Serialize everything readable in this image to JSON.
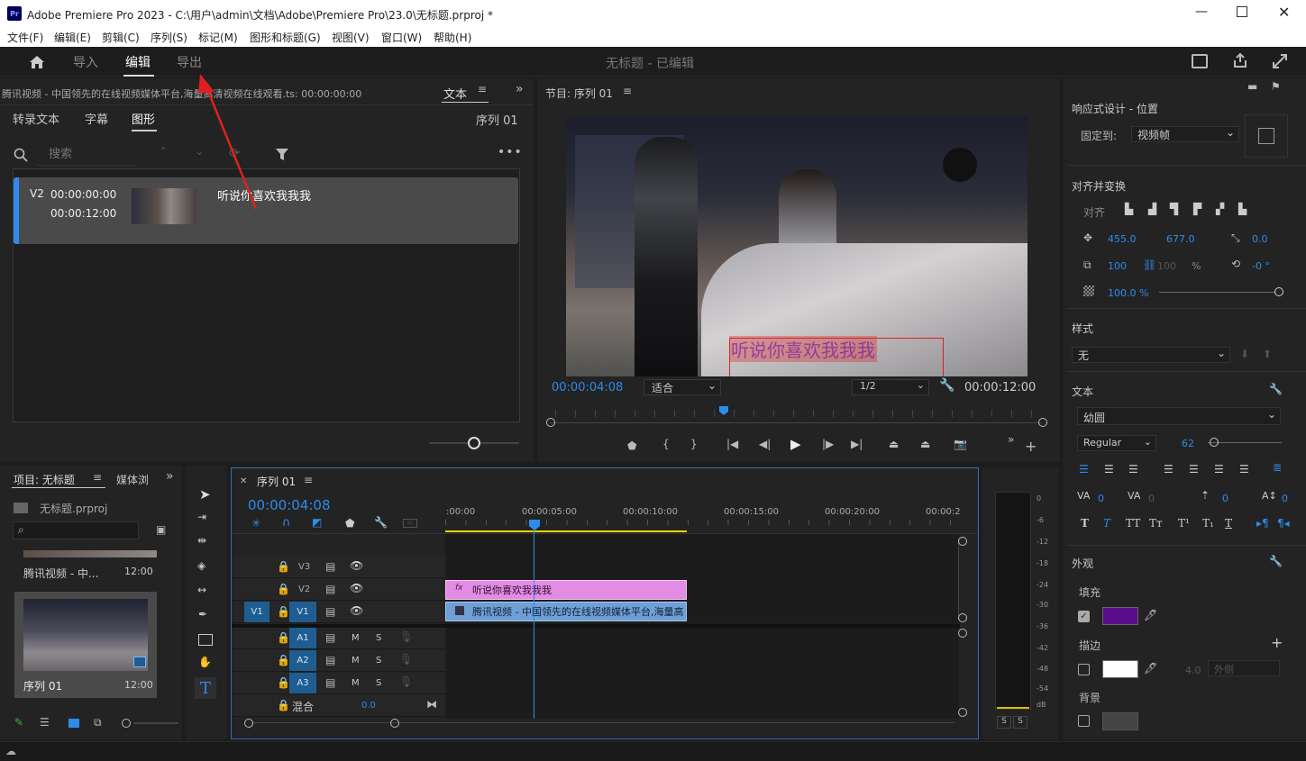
{
  "titlebar": {
    "app_icon": "Pr",
    "title": "Adobe Premiere Pro 2023 - C:\\用户\\admin\\文档\\Adobe\\Premiere Pro\\23.0\\无标题.prproj *"
  },
  "menu": [
    "文件(F)",
    "编辑(E)",
    "剪辑(C)",
    "序列(S)",
    "标记(M)",
    "图形和标题(G)",
    "视图(V)",
    "窗口(W)",
    "帮助(H)"
  ],
  "workspace": {
    "tabs": [
      "导入",
      "编辑",
      "导出"
    ],
    "active": "编辑",
    "project_status": "无标题 - 已编辑"
  },
  "text_panel": {
    "source_clip": "腾讯视频 - 中国领先的在线视频媒体平台,海量高清视频在线观看.ts: 00:00:00:00",
    "panel_title": "文本",
    "tabs": [
      "转录文本",
      "字幕",
      "图形"
    ],
    "active_tab": "图形",
    "sequence": "序列 01",
    "search_placeholder": "搜索",
    "item": {
      "track": "V2",
      "in": "00:00:00:00",
      "out": "00:00:12:00",
      "text": "听说你喜欢我我我"
    }
  },
  "program": {
    "title": "节目: 序列 01",
    "timecode": "00:00:04:08",
    "fit": "适合",
    "resolution": "1/2",
    "duration": "00:00:12:00",
    "overlay_text": "听说你喜欢我我我"
  },
  "project": {
    "tab": "项目: 无标题",
    "tab2": "媒体浏",
    "file": "无标题.prproj",
    "items": [
      {
        "name": "腾讯视频 - 中...",
        "duration": "12:00"
      },
      {
        "name": "序列 01",
        "duration": "12:00"
      }
    ]
  },
  "timeline": {
    "title": "序列 01",
    "timecode": "00:00:04:08",
    "ruler": [
      ":00:00",
      "00:00:05:00",
      "00:00:10:00",
      "00:00:15:00",
      "00:00:20:00",
      "00:00:2"
    ],
    "video_tracks": [
      "V3",
      "V2",
      "V1"
    ],
    "audio_tracks": [
      "A1",
      "A2",
      "A3"
    ],
    "mix_label": "混合",
    "mix_value": "0.0",
    "source_v1": "V1",
    "m": "M",
    "s": "S",
    "clip_v2": "听说你喜欢我我我",
    "clip_v1": "腾讯视频 - 中国领先的在线视频媒体平台,海量高",
    "fx_label": "fx"
  },
  "meter": {
    "scale": [
      "0",
      "-6",
      "-12",
      "-18",
      "-24",
      "-30",
      "-36",
      "-42",
      "-48",
      "-54",
      "dB"
    ],
    "solo": [
      "S",
      "S"
    ]
  },
  "props": {
    "responsive_title": "响应式设计 - 位置",
    "pin_label": "固定到:",
    "pin_value": "视频帧",
    "align_title": "对齐并变换",
    "align_label": "对齐",
    "pos_x": "455.0",
    "pos_y": "677.0",
    "anchor": "0.0",
    "scale": "100",
    "scale2": "100",
    "pct": "%",
    "rotation": "-0 °",
    "opacity": "100.0 %",
    "style_title": "样式",
    "style_value": "无",
    "text_title": "文本",
    "font": "幼圆",
    "font_style": "Regular",
    "font_size": "62",
    "tracking": "0",
    "kerning": "0",
    "leading": "0",
    "baseline": "0",
    "appearance_title": "外观",
    "fill_label": "填充",
    "fill_color": "#5a0d8a",
    "stroke_label": "描边",
    "stroke_width": "4.0",
    "stroke_type": "外侧",
    "bg_label": "背景"
  },
  "colors": {
    "accent": "#2d8ceb",
    "playhead": "#2d8ceb",
    "clip_graphic": "#d77fd9",
    "clip_video": "#6b9fd6",
    "arrow": "#e02020"
  }
}
